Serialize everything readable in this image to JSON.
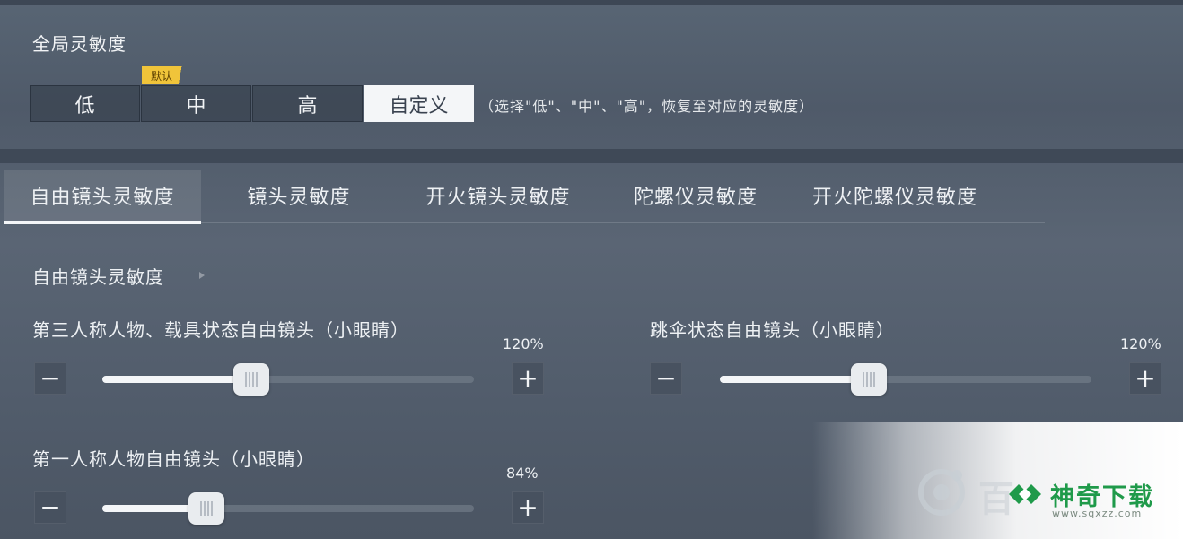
{
  "global": {
    "title": "全局灵敏度",
    "presets": [
      "低",
      "中",
      "高",
      "自定义"
    ],
    "selected_preset": "自定义",
    "default_tag": "默认",
    "hint": "（选择\"低\"、\"中\"、\"高\"，恢复至对应的灵敏度）"
  },
  "tabs": [
    {
      "label": "自由镜头灵敏度",
      "active": true
    },
    {
      "label": "镜头灵敏度",
      "active": false
    },
    {
      "label": "开火镜头灵敏度",
      "active": false
    },
    {
      "label": "陀螺仪灵敏度",
      "active": false
    },
    {
      "label": "开火陀螺仪灵敏度",
      "active": false
    }
  ],
  "section": {
    "title": "自由镜头灵敏度"
  },
  "sliders": [
    {
      "label": "第三人称人物、载具状态自由镜头（小眼睛）",
      "value_text": "120%",
      "fill_fraction": 0.4
    },
    {
      "label": "跳伞状态自由镜头（小眼睛）",
      "value_text": "120%",
      "fill_fraction": 0.4
    },
    {
      "label": "第一人称人物自由镜头（小眼睛）",
      "value_text": "84%",
      "fill_fraction": 0.28
    }
  ],
  "controls": {
    "minus": "−",
    "plus": "+"
  },
  "watermark": {
    "brand": "神奇下载",
    "url": "www.sqxzz.com",
    "partial_text": "百"
  },
  "colors": {
    "background": "#4d5866",
    "selected_button": "#f4f6f8",
    "default_tag": "#f0c43a",
    "brand_green": "#1f9a4a"
  }
}
